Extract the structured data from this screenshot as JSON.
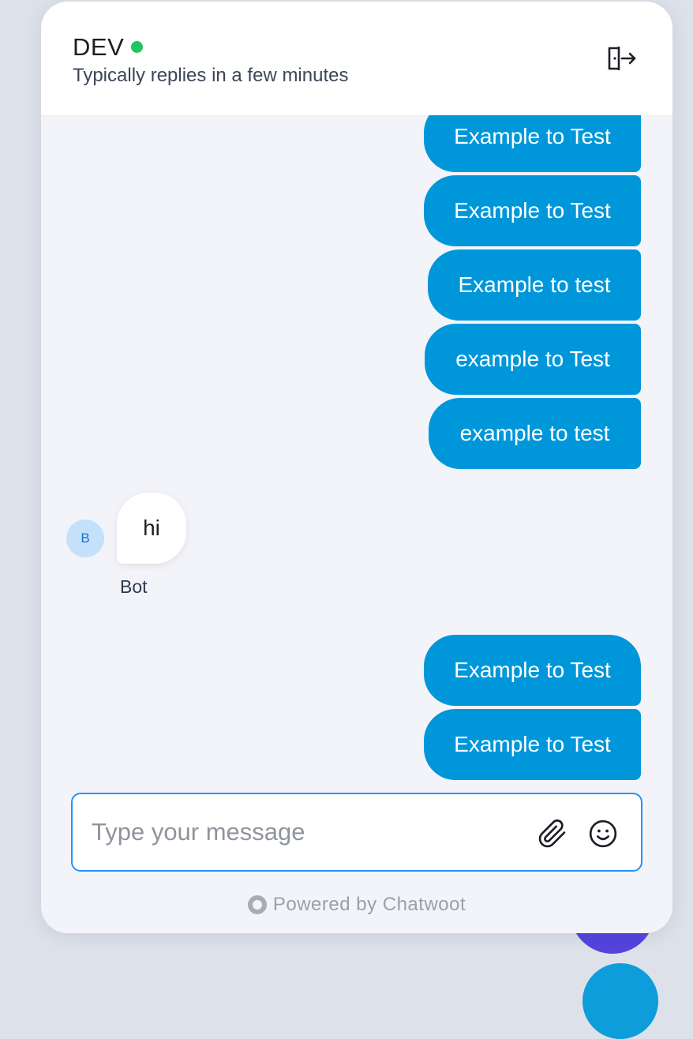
{
  "header": {
    "title": "DEV",
    "subtitle": "Typically replies in a few minutes",
    "status": "online",
    "exit_icon": "exit-door-icon"
  },
  "messages": {
    "outgoing_top": [
      "Example to Test",
      "Example to Test",
      "Example to test",
      "example to Test",
      "example to test"
    ],
    "incoming": {
      "avatar_initial": "B",
      "text": "hi",
      "sender": "Bot"
    },
    "outgoing_bottom": [
      "Example to Test",
      "Example to Test"
    ]
  },
  "composer": {
    "placeholder": "Type your message",
    "value": "",
    "attach_icon": "paperclip-icon",
    "emoji_icon": "smiley-icon"
  },
  "branding": {
    "text": "Powered by Chatwoot"
  },
  "colors": {
    "accent": "#1f93ff",
    "outgoing_bubble": "#0097da",
    "online": "#22c55e",
    "avatar_bg": "#c4e0fb",
    "launcher": "#5544dd"
  }
}
